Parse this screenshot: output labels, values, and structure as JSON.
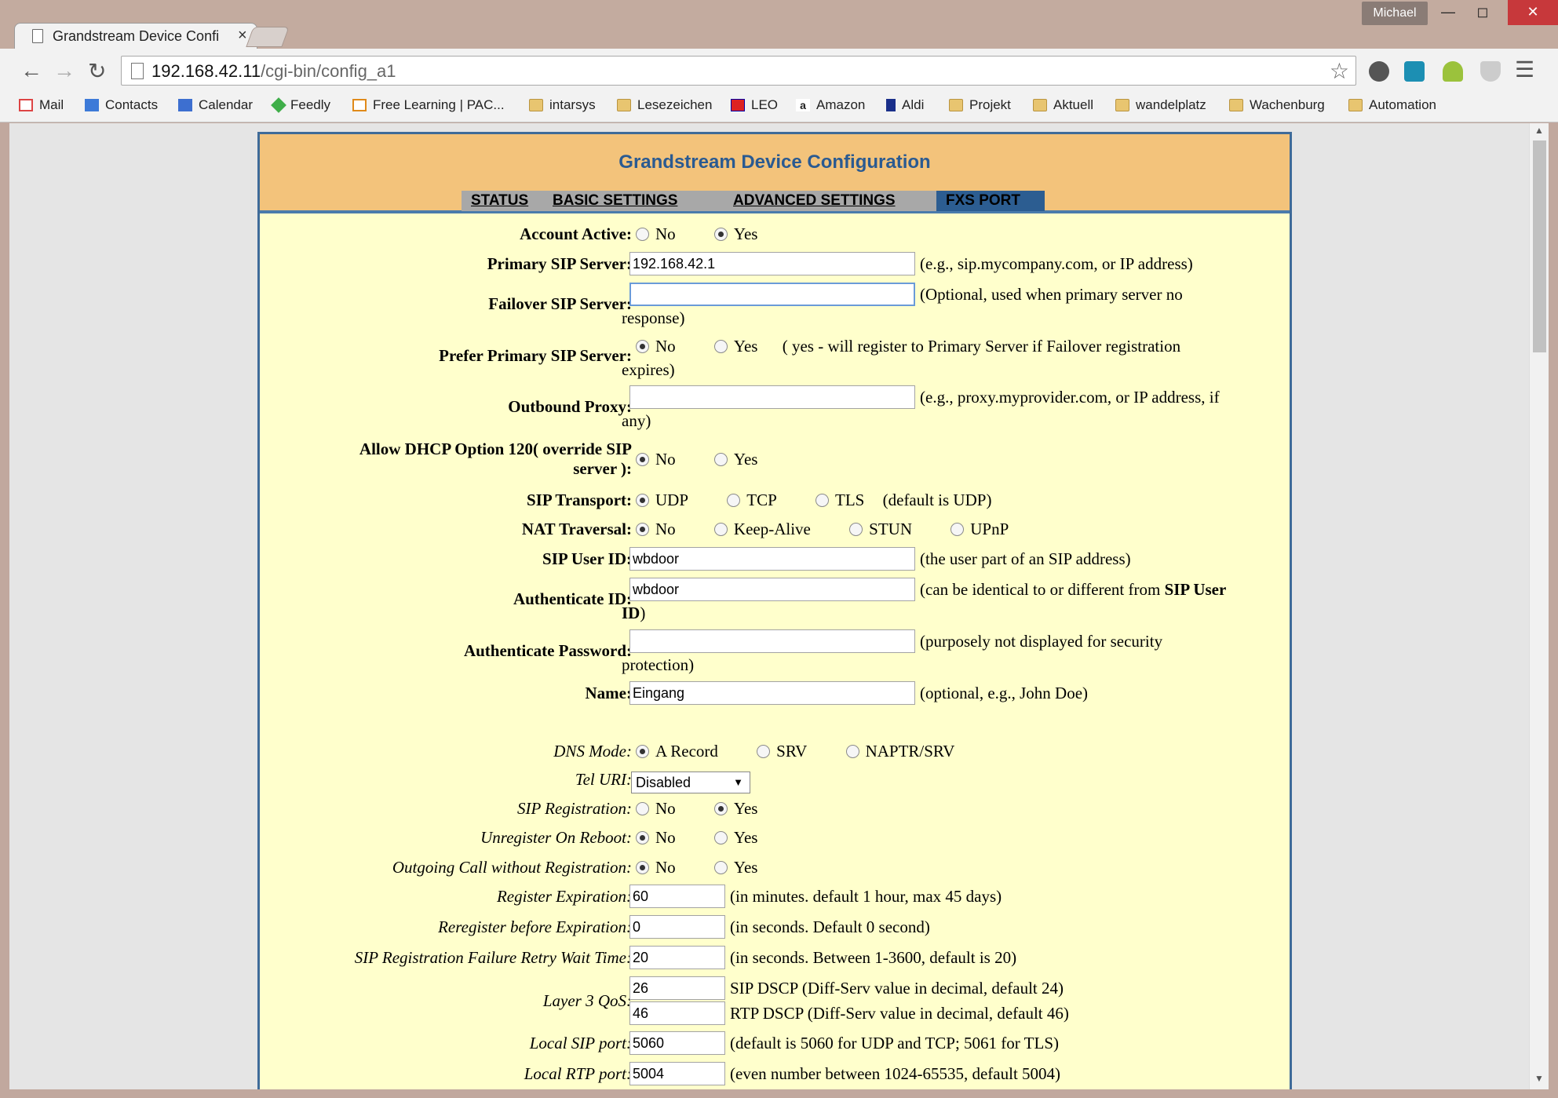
{
  "browser": {
    "tab_title": "Grandstream Device Confi",
    "tab_close": "×",
    "profile_name": "Michael",
    "url_host": "192.168.42.11",
    "url_path": "/cgi-bin/config_a1",
    "bookmarks": [
      "Mail",
      "Contacts",
      "Calendar",
      "Feedly",
      "Free Learning | PAC...",
      "intarsys",
      "Lesezeichen",
      "LEO",
      "Amazon",
      "Aldi",
      "Projekt",
      "Aktuell",
      "wandelplatz",
      "Wachenburg",
      "Automation"
    ]
  },
  "page": {
    "title": "Grandstream Device Configuration",
    "tabs": [
      "STATUS",
      "BASIC SETTINGS",
      "ADVANCED SETTINGS",
      "FXS PORT"
    ],
    "active_tab": "FXS PORT"
  },
  "form": {
    "account_active": {
      "label": "Account Active:",
      "opt_no": "No",
      "opt_yes": "Yes",
      "selected": "Yes"
    },
    "primary_sip": {
      "label": "Primary SIP Server:",
      "value": "192.168.42.1",
      "hint": "(e.g., sip.mycompany.com, or IP address)"
    },
    "failover_sip": {
      "label": "Failover SIP Server:",
      "value": "",
      "hint1": "(Optional, used when primary server no",
      "hint2": "response)"
    },
    "prefer_primary": {
      "label": "Prefer Primary SIP Server:",
      "opt_no": "No",
      "opt_yes": "Yes",
      "selected": "No",
      "hint1": "( yes - will register to Primary Server if Failover registration",
      "hint2": "expires)"
    },
    "outbound_proxy": {
      "label": "Outbound Proxy:",
      "value": "",
      "hint1": "(e.g., proxy.myprovider.com, or IP address, if",
      "hint2": "any)"
    },
    "dhcp120": {
      "label1": "Allow DHCP Option 120( override SIP",
      "label2": "server ):",
      "opt_no": "No",
      "opt_yes": "Yes",
      "selected": "No"
    },
    "sip_transport": {
      "label": "SIP Transport:",
      "opt_udp": "UDP",
      "opt_tcp": "TCP",
      "opt_tls": "TLS",
      "hint": "(default is UDP)",
      "selected": "UDP"
    },
    "nat_traversal": {
      "label": "NAT Traversal:",
      "opt_no": "No",
      "opt_keep": "Keep-Alive",
      "opt_stun": "STUN",
      "opt_upnp": "UPnP",
      "selected": "No"
    },
    "sip_user_id": {
      "label": "SIP User ID:",
      "value": "wbdoor",
      "hint": "(the user part of an SIP address)"
    },
    "auth_id": {
      "label": "Authenticate ID:",
      "value": "wbdoor",
      "hint1": "(can be identical to or different from ",
      "hint_bold1": "SIP User",
      "hint_bold2": "ID",
      "hint2": ")"
    },
    "auth_password": {
      "label": "Authenticate Password:",
      "value": "",
      "hint1": "(purposely not displayed for security",
      "hint2": "protection)"
    },
    "name": {
      "label": "Name:",
      "value": "Eingang",
      "hint": "(optional, e.g., John Doe)"
    },
    "dns_mode": {
      "label": "DNS Mode:",
      "opt_a": "A Record",
      "opt_srv": "SRV",
      "opt_naptr": "NAPTR/SRV",
      "selected": "A Record"
    },
    "tel_uri": {
      "label": "Tel URI:",
      "value": "Disabled",
      "arrow": "▼"
    },
    "sip_registration": {
      "label": "SIP Registration:",
      "opt_no": "No",
      "opt_yes": "Yes",
      "selected": "Yes"
    },
    "unregister_reboot": {
      "label": "Unregister On Reboot:",
      "opt_no": "No",
      "opt_yes": "Yes",
      "selected": "No"
    },
    "outgoing_no_reg": {
      "label": "Outgoing Call without Registration:",
      "opt_no": "No",
      "opt_yes": "Yes",
      "selected": "No"
    },
    "register_expiration": {
      "label": "Register Expiration:",
      "value": "60",
      "hint": "(in minutes. default 1 hour, max 45 days)"
    },
    "reregister_before": {
      "label": "Reregister before Expiration:",
      "value": "0",
      "hint": "(in seconds. Default 0 second)"
    },
    "retry_wait": {
      "label": "SIP Registration Failure Retry Wait Time:",
      "value": "20",
      "hint": "(in seconds. Between 1-3600, default is 20)"
    },
    "layer3_qos": {
      "label": "Layer 3 QoS:",
      "sip_value": "26",
      "sip_hint": "SIP DSCP (Diff-Serv value in decimal, default 24)",
      "rtp_value": "46",
      "rtp_hint": "RTP DSCP (Diff-Serv value in decimal, default 46)"
    },
    "local_sip_port": {
      "label": "Local SIP port:",
      "value": "5060",
      "hint": "(default is 5060 for UDP and TCP; 5061 for TLS)"
    },
    "local_rtp_port": {
      "label": "Local RTP port:",
      "value": "5004",
      "hint": "(even number between 1024-65535, default 5004)"
    }
  }
}
